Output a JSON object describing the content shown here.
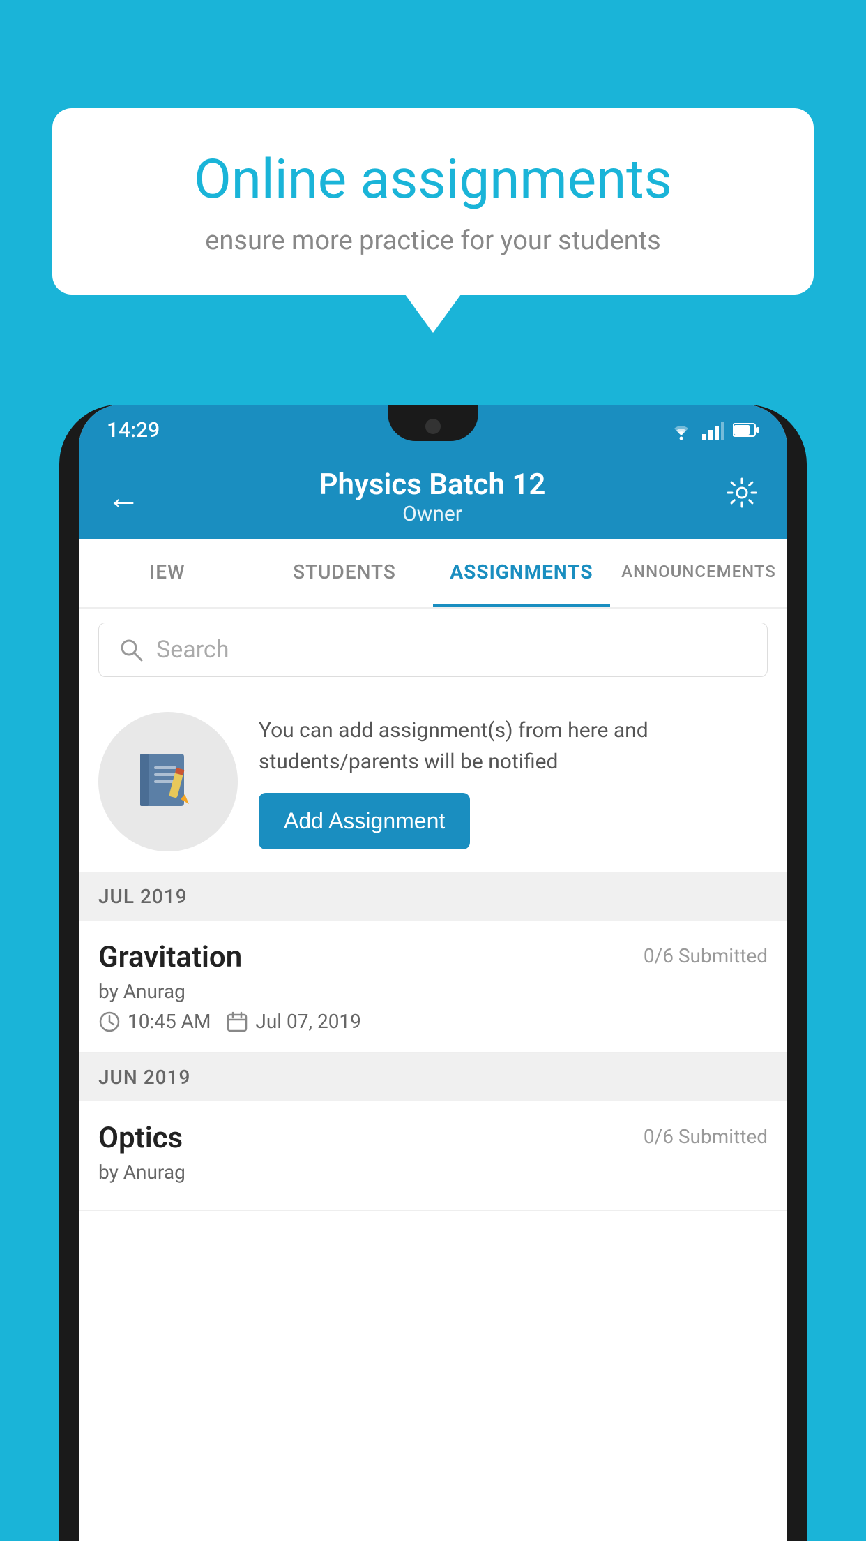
{
  "background_color": "#1ab4d8",
  "speech_bubble": {
    "title": "Online assignments",
    "subtitle": "ensure more practice for your students"
  },
  "status_bar": {
    "time": "14:29",
    "wifi": "▼",
    "signal": "▲",
    "battery": "▮"
  },
  "app_bar": {
    "title": "Physics Batch 12",
    "subtitle": "Owner",
    "back_label": "←",
    "settings_label": "⚙"
  },
  "tabs": [
    {
      "label": "IEW",
      "active": false
    },
    {
      "label": "STUDENTS",
      "active": false
    },
    {
      "label": "ASSIGNMENTS",
      "active": true
    },
    {
      "label": "ANNOUNCEMENTS",
      "active": false
    }
  ],
  "search": {
    "placeholder": "Search"
  },
  "promo": {
    "description": "You can add assignment(s) from here and students/parents will be notified",
    "button_label": "Add Assignment"
  },
  "sections": [
    {
      "header": "JUL 2019",
      "assignments": [
        {
          "name": "Gravitation",
          "submitted": "0/6 Submitted",
          "by": "by Anurag",
          "time": "10:45 AM",
          "date": "Jul 07, 2019"
        }
      ]
    },
    {
      "header": "JUN 2019",
      "assignments": [
        {
          "name": "Optics",
          "submitted": "0/6 Submitted",
          "by": "by Anurag",
          "time": "",
          "date": ""
        }
      ]
    }
  ]
}
